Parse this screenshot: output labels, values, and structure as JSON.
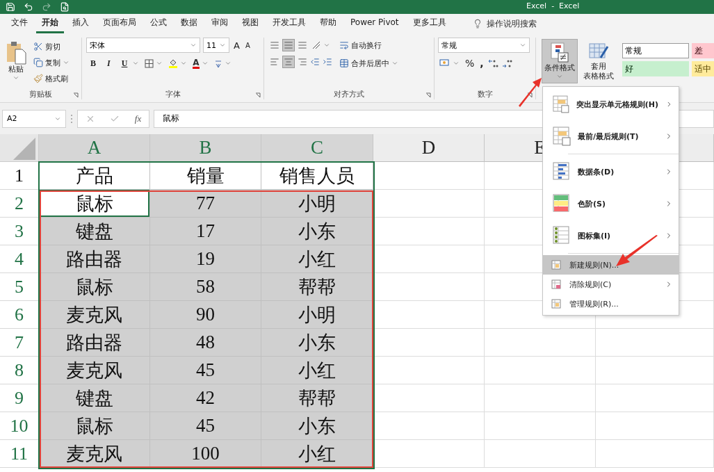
{
  "window": {
    "title": "Excel  -  Excel"
  },
  "tabs": [
    {
      "label": "文件",
      "selected": false
    },
    {
      "label": "开始",
      "selected": true
    },
    {
      "label": "插入",
      "selected": false
    },
    {
      "label": "页面布局",
      "selected": false
    },
    {
      "label": "公式",
      "selected": false
    },
    {
      "label": "数据",
      "selected": false
    },
    {
      "label": "审阅",
      "selected": false
    },
    {
      "label": "视图",
      "selected": false
    },
    {
      "label": "开发工具",
      "selected": false
    },
    {
      "label": "帮助",
      "selected": false
    },
    {
      "label": "Power Pivot",
      "selected": false
    },
    {
      "label": "更多工具",
      "selected": false
    }
  ],
  "tell_me": {
    "placeholder": "操作说明搜索"
  },
  "ribbon": {
    "clipboard": {
      "paste": "粘贴",
      "cut": "剪切",
      "copy": "复制",
      "format_painter": "格式刷",
      "label": "剪贴板"
    },
    "font": {
      "name": "宋体",
      "size": "11",
      "grow": "A",
      "shrink": "A",
      "bold": "B",
      "italic": "I",
      "underline": "U",
      "color_letter": "A",
      "label": "字体"
    },
    "alignment": {
      "wrap": "自动换行",
      "merge": "合并后居中",
      "label": "对齐方式"
    },
    "number": {
      "format": "常规",
      "percent": "%",
      "comma": ",",
      "label": "数字"
    },
    "conditional_format": {
      "label": "条件格式",
      "selected": true
    },
    "table_format": {
      "label_lines": [
        "套用",
        "表格格式"
      ]
    },
    "styles": [
      {
        "label": "常规",
        "color": "#ffffff"
      },
      {
        "label": "差",
        "color": "#ffc7ce"
      },
      {
        "label": "好",
        "color": "#c6efce"
      },
      {
        "label": "适中",
        "color": "#ffeb9c"
      }
    ]
  },
  "formula_bar": {
    "name_box": "A2",
    "fx": "fx",
    "value": "鼠标"
  },
  "sheet": {
    "columns": [
      {
        "label": "A",
        "selected": true
      },
      {
        "label": "B",
        "selected": true
      },
      {
        "label": "C",
        "selected": true
      },
      {
        "label": "D",
        "selected": false
      },
      {
        "label": "E",
        "selected": false
      }
    ],
    "rows": [
      {
        "header": "1",
        "selected": false,
        "cells": [
          {
            "text": "产品",
            "active": false
          },
          {
            "text": "销量",
            "active": false
          },
          {
            "text": "销售人员",
            "active": false
          }
        ]
      },
      {
        "header": "2",
        "selected": true,
        "cells": [
          {
            "text": "鼠标",
            "active": true
          },
          {
            "text": "77",
            "active": false
          },
          {
            "text": "小明",
            "active": false
          }
        ]
      },
      {
        "header": "3",
        "selected": true,
        "cells": [
          {
            "text": "键盘",
            "active": false
          },
          {
            "text": "17",
            "active": false
          },
          {
            "text": "小东",
            "active": false
          }
        ]
      },
      {
        "header": "4",
        "selected": true,
        "cells": [
          {
            "text": "路由器",
            "active": false
          },
          {
            "text": "19",
            "active": false
          },
          {
            "text": "小红",
            "active": false
          }
        ]
      },
      {
        "header": "5",
        "selected": true,
        "cells": [
          {
            "text": "鼠标",
            "active": false
          },
          {
            "text": "58",
            "active": false
          },
          {
            "text": "帮帮",
            "active": false
          }
        ]
      },
      {
        "header": "6",
        "selected": true,
        "cells": [
          {
            "text": "麦克风",
            "active": false
          },
          {
            "text": "90",
            "active": false
          },
          {
            "text": "小明",
            "active": false
          }
        ]
      },
      {
        "header": "7",
        "selected": true,
        "cells": [
          {
            "text": "路由器",
            "active": false
          },
          {
            "text": "48",
            "active": false
          },
          {
            "text": "小东",
            "active": false
          }
        ]
      },
      {
        "header": "8",
        "selected": true,
        "cells": [
          {
            "text": "麦克风",
            "active": false
          },
          {
            "text": "45",
            "active": false
          },
          {
            "text": "小红",
            "active": false
          }
        ]
      },
      {
        "header": "9",
        "selected": true,
        "cells": [
          {
            "text": "键盘",
            "active": false
          },
          {
            "text": "42",
            "active": false
          },
          {
            "text": "帮帮",
            "active": false
          }
        ]
      },
      {
        "header": "10",
        "selected": true,
        "cells": [
          {
            "text": "鼠标",
            "active": false
          },
          {
            "text": "45",
            "active": false
          },
          {
            "text": "小东",
            "active": false
          }
        ]
      },
      {
        "header": "11",
        "selected": true,
        "cells": [
          {
            "text": "麦克风",
            "active": false
          },
          {
            "text": "100",
            "active": false
          },
          {
            "text": "小红",
            "active": false
          }
        ]
      }
    ]
  },
  "menu": {
    "groups": [
      [
        {
          "label": "突出显示单元格规则(H)",
          "kind": "large",
          "submenu": true,
          "selected": false
        },
        {
          "label": "最前/最后规则(T)",
          "kind": "large",
          "submenu": true,
          "selected": false
        }
      ],
      [
        {
          "label": "数据条(D)",
          "kind": "large",
          "submenu": true,
          "selected": false
        },
        {
          "label": "色阶(S)",
          "kind": "large",
          "submenu": true,
          "selected": false
        },
        {
          "label": "图标集(I)",
          "kind": "large",
          "submenu": true,
          "selected": false
        }
      ],
      [
        {
          "label": "新建规则(N)...",
          "kind": "small",
          "submenu": false,
          "selected": true
        },
        {
          "label": "清除规则(C)",
          "kind": "small",
          "submenu": true,
          "selected": false
        },
        {
          "label": "管理规则(R)...",
          "kind": "small",
          "submenu": false,
          "selected": false
        }
      ]
    ]
  }
}
